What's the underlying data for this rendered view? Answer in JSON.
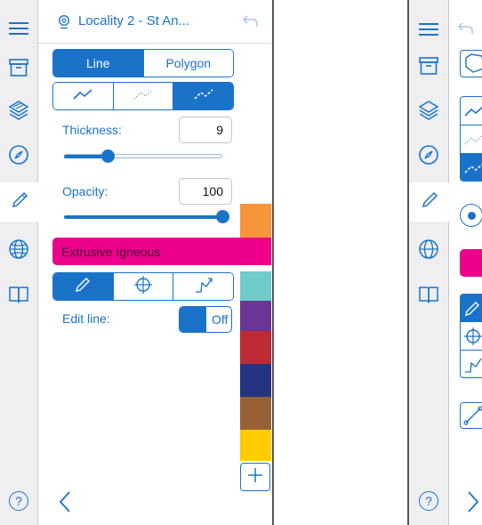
{
  "header": {
    "locality_title": "Locality 2 - St An..."
  },
  "mode_tabs": [
    "Line",
    "Polygon"
  ],
  "thickness": {
    "label": "Thickness:",
    "value": "9",
    "level": 0.22
  },
  "opacity": {
    "label": "Opacity:",
    "value": "100",
    "level": 1.0
  },
  "unit": {
    "name": "Extrusive Igneous",
    "color": "#ec008c"
  },
  "edit_line": {
    "label": "Edit line:",
    "toggle_label": "Off"
  },
  "palette": [
    "#f7953b",
    "#ec008c",
    "#6fcbcc",
    "#6a3596",
    "#be2b36",
    "#263382",
    "#996236",
    "#ffcc00"
  ],
  "icons": {
    "rail": [
      "menu-icon",
      "archive-icon",
      "layers-icon",
      "compass-icon",
      "pencil-icon",
      "globe-icon",
      "book-icon",
      "help-icon"
    ],
    "header": [
      "location-pin-icon",
      "undo-icon"
    ],
    "footer": [
      "back-chevron-icon",
      "add-icon"
    ]
  },
  "help_label": "?",
  "accent_color": "#1a73c8"
}
